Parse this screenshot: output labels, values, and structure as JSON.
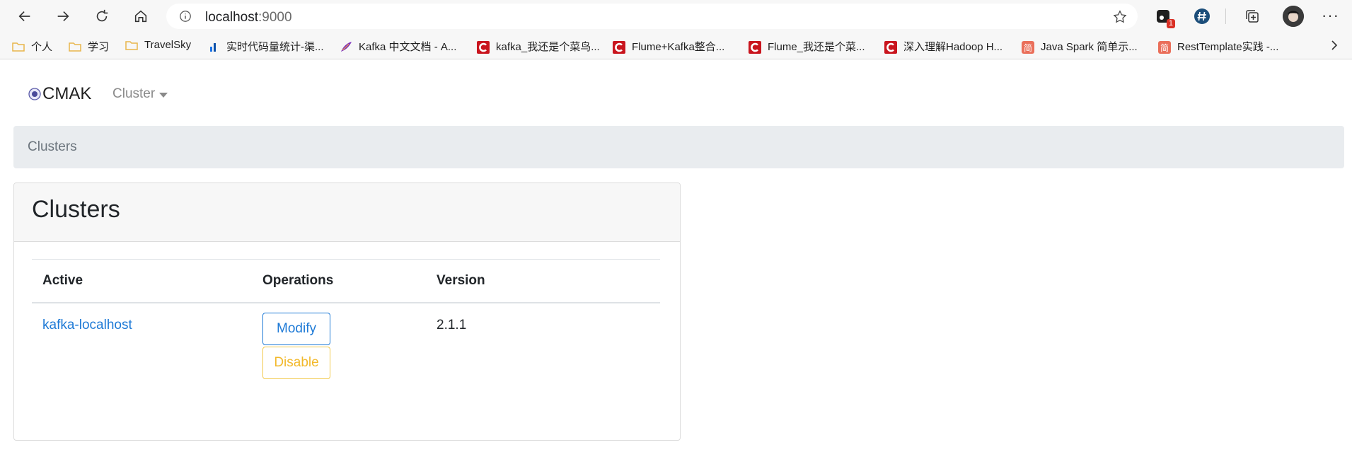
{
  "browser": {
    "url_host": "localhost",
    "url_port": ":9000",
    "extension_badge": "1",
    "bookmarks": [
      {
        "label": "个人",
        "icon": "folder-icon",
        "color": "#e8b64c"
      },
      {
        "label": "学习",
        "icon": "folder-icon",
        "color": "#e8b64c"
      },
      {
        "label": "TravelSky",
        "icon": "folder-icon",
        "color": "#e8b64c"
      },
      {
        "label": "实时代码量统计-渠...",
        "icon": "bar-chart-icon",
        "color": "#1a73e8"
      },
      {
        "label": "Kafka 中文文档 - A...",
        "icon": "feather-icon",
        "color": "#7b2fbe"
      },
      {
        "label": "kafka_我还是个菜鸟...",
        "icon": "csdn-icon",
        "color": "#c9151e"
      },
      {
        "label": "Flume+Kafka整合...",
        "icon": "csdn-icon",
        "color": "#c9151e"
      },
      {
        "label": "Flume_我还是个菜...",
        "icon": "csdn-icon",
        "color": "#c9151e"
      },
      {
        "label": "深入理解Hadoop H...",
        "icon": "csdn-icon",
        "color": "#c9151e"
      },
      {
        "label": "Java Spark 简单示...",
        "icon": "jianshu-icon",
        "color": "#ea6f5a"
      },
      {
        "label": "RestTemplate实践 -...",
        "icon": "jianshu-icon",
        "color": "#ea6f5a"
      }
    ]
  },
  "app": {
    "brand": "CMAK",
    "menu_cluster": "Cluster",
    "breadcrumb": "Clusters"
  },
  "card": {
    "title": "Clusters",
    "columns": [
      "Active",
      "Operations",
      "Version"
    ],
    "rows": [
      {
        "name": "kafka-localhost",
        "modify": "Modify",
        "disable": "Disable",
        "version": "2.1.1"
      }
    ]
  },
  "colors": {
    "link": "#1e7ad6",
    "warning": "#f2b92c",
    "breadcrumb_bg": "#e9ecef"
  }
}
